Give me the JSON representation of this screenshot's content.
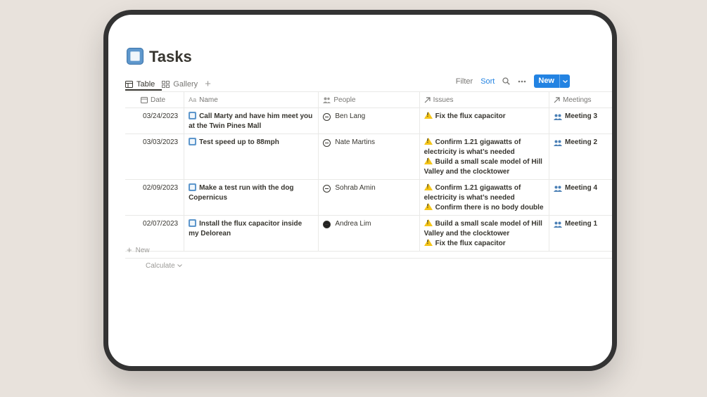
{
  "page": {
    "title": "Tasks",
    "icon": "blue-square-icon"
  },
  "views": {
    "tabs": [
      {
        "label": "Table",
        "icon": "table-icon",
        "active": true
      },
      {
        "label": "Gallery",
        "icon": "gallery-icon",
        "active": false
      }
    ],
    "add_icon": "plus-icon"
  },
  "toolbar": {
    "filter_label": "Filter",
    "sort_label": "Sort",
    "search_icon": "search-icon",
    "more_icon": "more-icon",
    "new_label": "New"
  },
  "table": {
    "columns": [
      {
        "label": "Date",
        "icon": "calendar-icon"
      },
      {
        "label": "Name",
        "icon": "text-icon"
      },
      {
        "label": "People",
        "icon": "people-icon"
      },
      {
        "label": "Issues",
        "icon": "relation-arrow-icon"
      },
      {
        "label": "Meetings",
        "icon": "relation-arrow-icon"
      }
    ],
    "rows": [
      {
        "date": "03/24/2023",
        "name": "Call Marty and have him meet you at the Twin Pines Mall",
        "person": "Ben Lang",
        "issues": [
          "Fix the flux capacitor"
        ],
        "meeting": "Meeting 3"
      },
      {
        "date": "03/03/2023",
        "name": "Test speed up to 88mph",
        "person": "Nate Martins",
        "issues": [
          "Confirm 1.21 gigawatts  of electricity is what’s needed",
          "Build a small scale model of Hill Valley and the clocktower"
        ],
        "meeting": "Meeting 2"
      },
      {
        "date": "02/09/2023",
        "name": "Make a test run with the dog Copernicus",
        "person": "Sohrab Amin",
        "issues": [
          "Confirm 1.21 gigawatts  of electricity is what’s needed",
          "Confirm there is no body double"
        ],
        "meeting": "Meeting 4"
      },
      {
        "date": "02/07/2023",
        "name": "Install the flux capacitor inside my Delorean",
        "person": "Andrea Lim",
        "issues": [
          "Build a small scale model of Hill Valley and the clocktower",
          "Fix the flux capacitor"
        ],
        "meeting": "Meeting 1"
      }
    ],
    "new_row_label": "New",
    "calculate_label": "Calculate"
  },
  "colors": {
    "accent": "#2383e2",
    "text": "#37352f",
    "muted": "#787774",
    "border": "#e9e9e7",
    "warning": "#f5c518",
    "background": "#e8e2dc"
  }
}
